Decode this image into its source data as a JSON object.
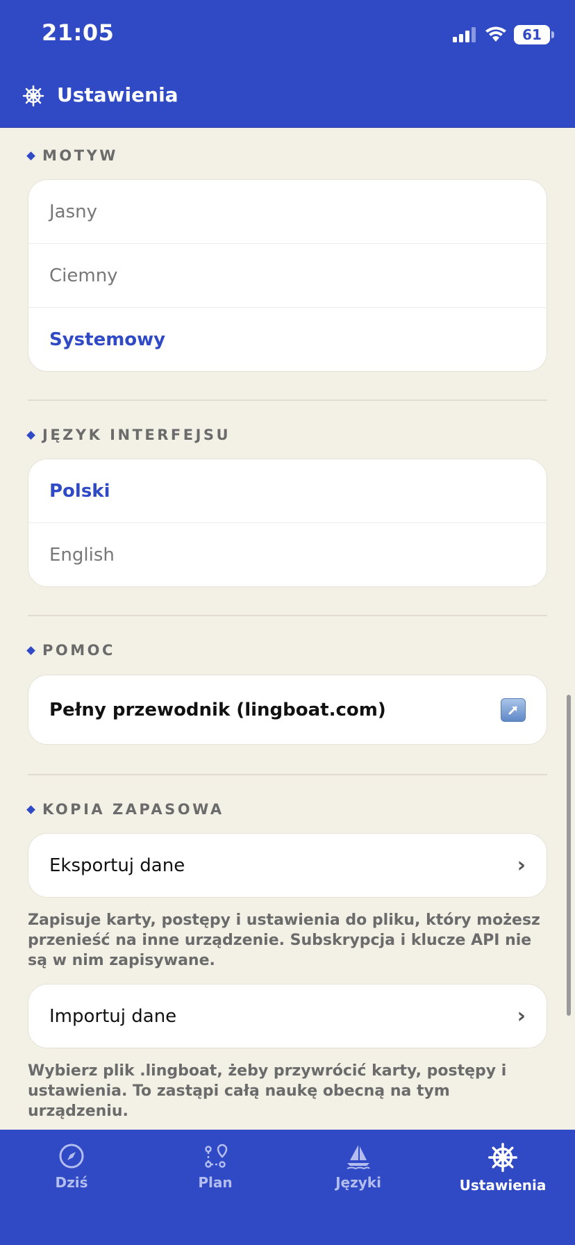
{
  "status": {
    "time": "21:05",
    "battery": "61"
  },
  "header": {
    "title": "Ustawienia",
    "icon": "ship-wheel-icon"
  },
  "sections": {
    "theme": {
      "title": "MOTYW",
      "options": [
        "Jasny",
        "Ciemny",
        "Systemowy"
      ],
      "selected": "Systemowy"
    },
    "language": {
      "title": "JĘZYK INTERFEJSU",
      "options": [
        "Polski",
        "English"
      ],
      "selected": "Polski"
    },
    "help": {
      "title": "POMOC",
      "guide_label": "Pełny przewodnik (lingboat.com)",
      "icon": "external-link-icon"
    },
    "backup": {
      "title": "KOPIA ZAPASOWA",
      "export_label": "Eksportuj dane",
      "export_note": "Zapisuje karty, postępy i ustawienia do pliku, który możesz przenieść na inne urządzenie. Subskrypcja i klucze API nie są w nim zapisywane.",
      "import_label": "Importuj dane",
      "import_note": "Wybierz plik .lingboat, żeby przywrócić karty, postępy i ustawienia. To zastąpi całą naukę obecną na tym urządzeniu."
    }
  },
  "tabs": [
    {
      "label": "Dziś",
      "icon": "compass-icon"
    },
    {
      "label": "Plan",
      "icon": "route-icon"
    },
    {
      "label": "Języki",
      "icon": "sailboat-icon"
    },
    {
      "label": "Ustawienia",
      "icon": "ship-wheel-icon",
      "active": true
    }
  ],
  "colors": {
    "accent": "#304AC6",
    "background": "#F3F0E6"
  }
}
